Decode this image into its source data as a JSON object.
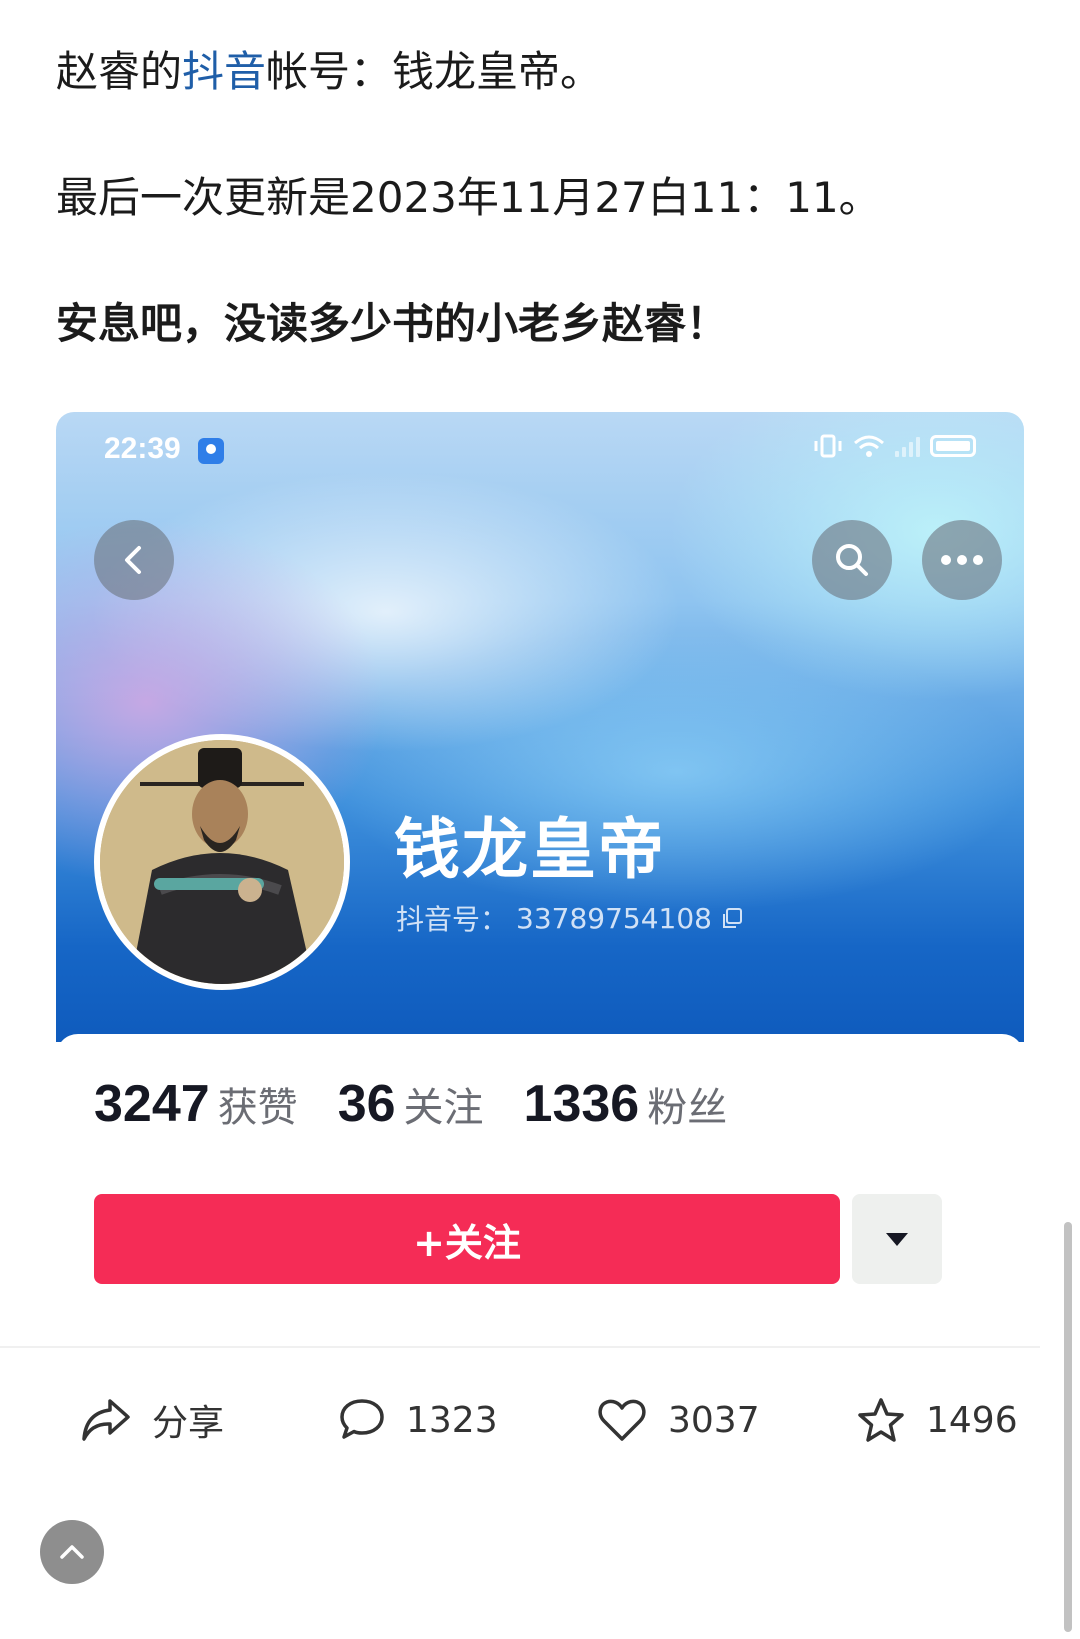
{
  "article": {
    "line1_prefix": "赵睿的",
    "line1_link": "抖音",
    "line1_suffix": "帐号：钱龙皇帝。",
    "line2": "最后一次更新是2023年11月27白11：11。",
    "line3": "安息吧，没读多少书的小老乡赵睿！"
  },
  "screenshot": {
    "status_time": "22:39",
    "nickname": "钱龙皇帝",
    "douyin_id_label": "抖音号：",
    "douyin_id": "33789754108",
    "stats": [
      {
        "value": "3247",
        "label": "获赞"
      },
      {
        "value": "36",
        "label": "关注"
      },
      {
        "value": "1336",
        "label": "粉丝"
      }
    ],
    "follow_label": "+关注",
    "icons": {
      "back": "chevron-left-icon",
      "search": "search-icon",
      "more": "more-icon",
      "dropdown": "caret-down-icon",
      "copy": "copy-icon"
    },
    "colors": {
      "follow_button": "#f52c56",
      "banner_blue": "#1666c6"
    }
  },
  "action_bar": {
    "share_label": "分享",
    "comments": "1323",
    "likes": "3037",
    "favorites": "1496"
  }
}
